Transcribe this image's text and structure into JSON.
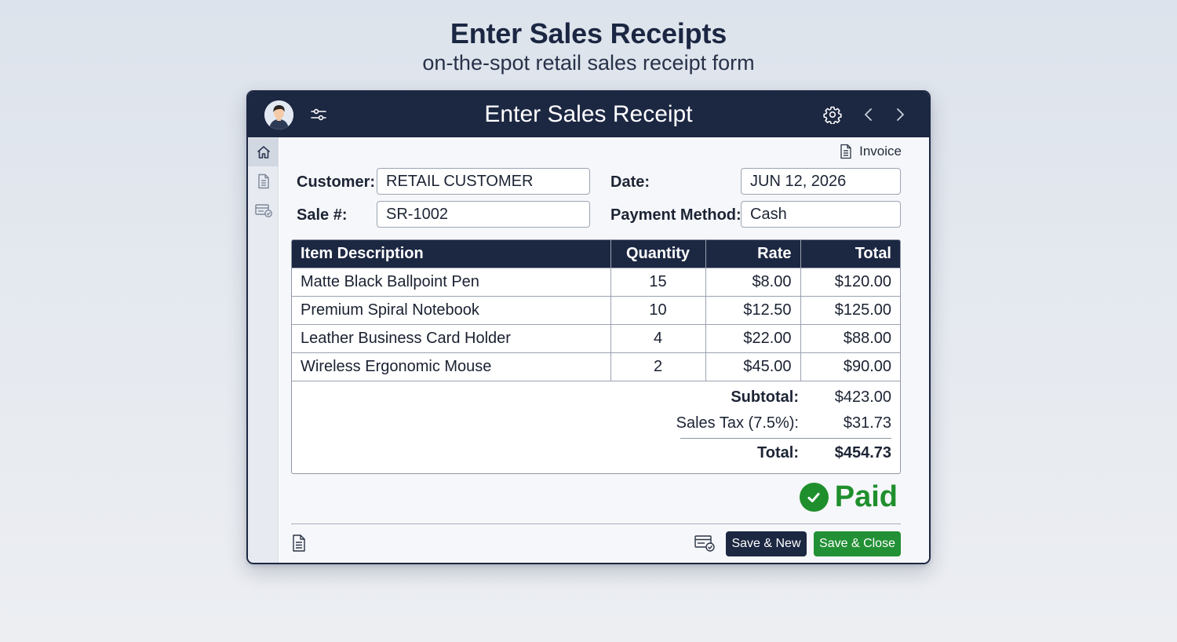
{
  "heading": {
    "title": "Enter Sales Receipts",
    "subtitle": "on-the-spot retail sales receipt form"
  },
  "window": {
    "title": "Enter Sales Receipt",
    "icons": [
      "avatar",
      "sliders-icon",
      "gear-icon",
      "chevron-left-icon",
      "chevron-right-icon"
    ]
  },
  "sidebar": {
    "items": [
      {
        "name": "home-icon",
        "active": true
      },
      {
        "name": "document-icon",
        "active": false
      },
      {
        "name": "receipt-check-icon",
        "active": false
      }
    ]
  },
  "invoice_link": "Invoice",
  "form": {
    "customer_label": "Customer:",
    "customer_value": "RETAIL CUSTOMER",
    "date_label": "Date:",
    "date_value": "JUN 12, 2026",
    "sale_label": "Sale #:",
    "sale_value": "SR-1002",
    "payment_label": "Payment Method:",
    "payment_value": "Cash"
  },
  "table": {
    "headers": [
      "Item Description",
      "Quantity",
      "Rate",
      "Total"
    ],
    "rows": [
      {
        "desc": "Matte Black Ballpoint Pen",
        "qty": "15",
        "rate": "$8.00",
        "total": "$120.00"
      },
      {
        "desc": "Premium Spiral Notebook",
        "qty": "10",
        "rate": "$12.50",
        "total": "$125.00"
      },
      {
        "desc": "Leather Business Card Holder",
        "qty": "4",
        "rate": "$22.00",
        "total": "$88.00"
      },
      {
        "desc": "Wireless Ergonomic Mouse",
        "qty": "2",
        "rate": "$45.00",
        "total": "$90.00"
      }
    ]
  },
  "summary": {
    "subtotal_label": "Subtotal:",
    "subtotal_value": "$423.00",
    "tax_label": "Sales Tax (7.5%):",
    "tax_value": "$31.73",
    "total_label": "Total:",
    "total_value": "$454.73"
  },
  "status": "Paid",
  "buttons": {
    "save_new": "Save & New",
    "save_close": "Save & Close"
  },
  "colors": {
    "navy": "#1c2742",
    "green": "#229035"
  }
}
